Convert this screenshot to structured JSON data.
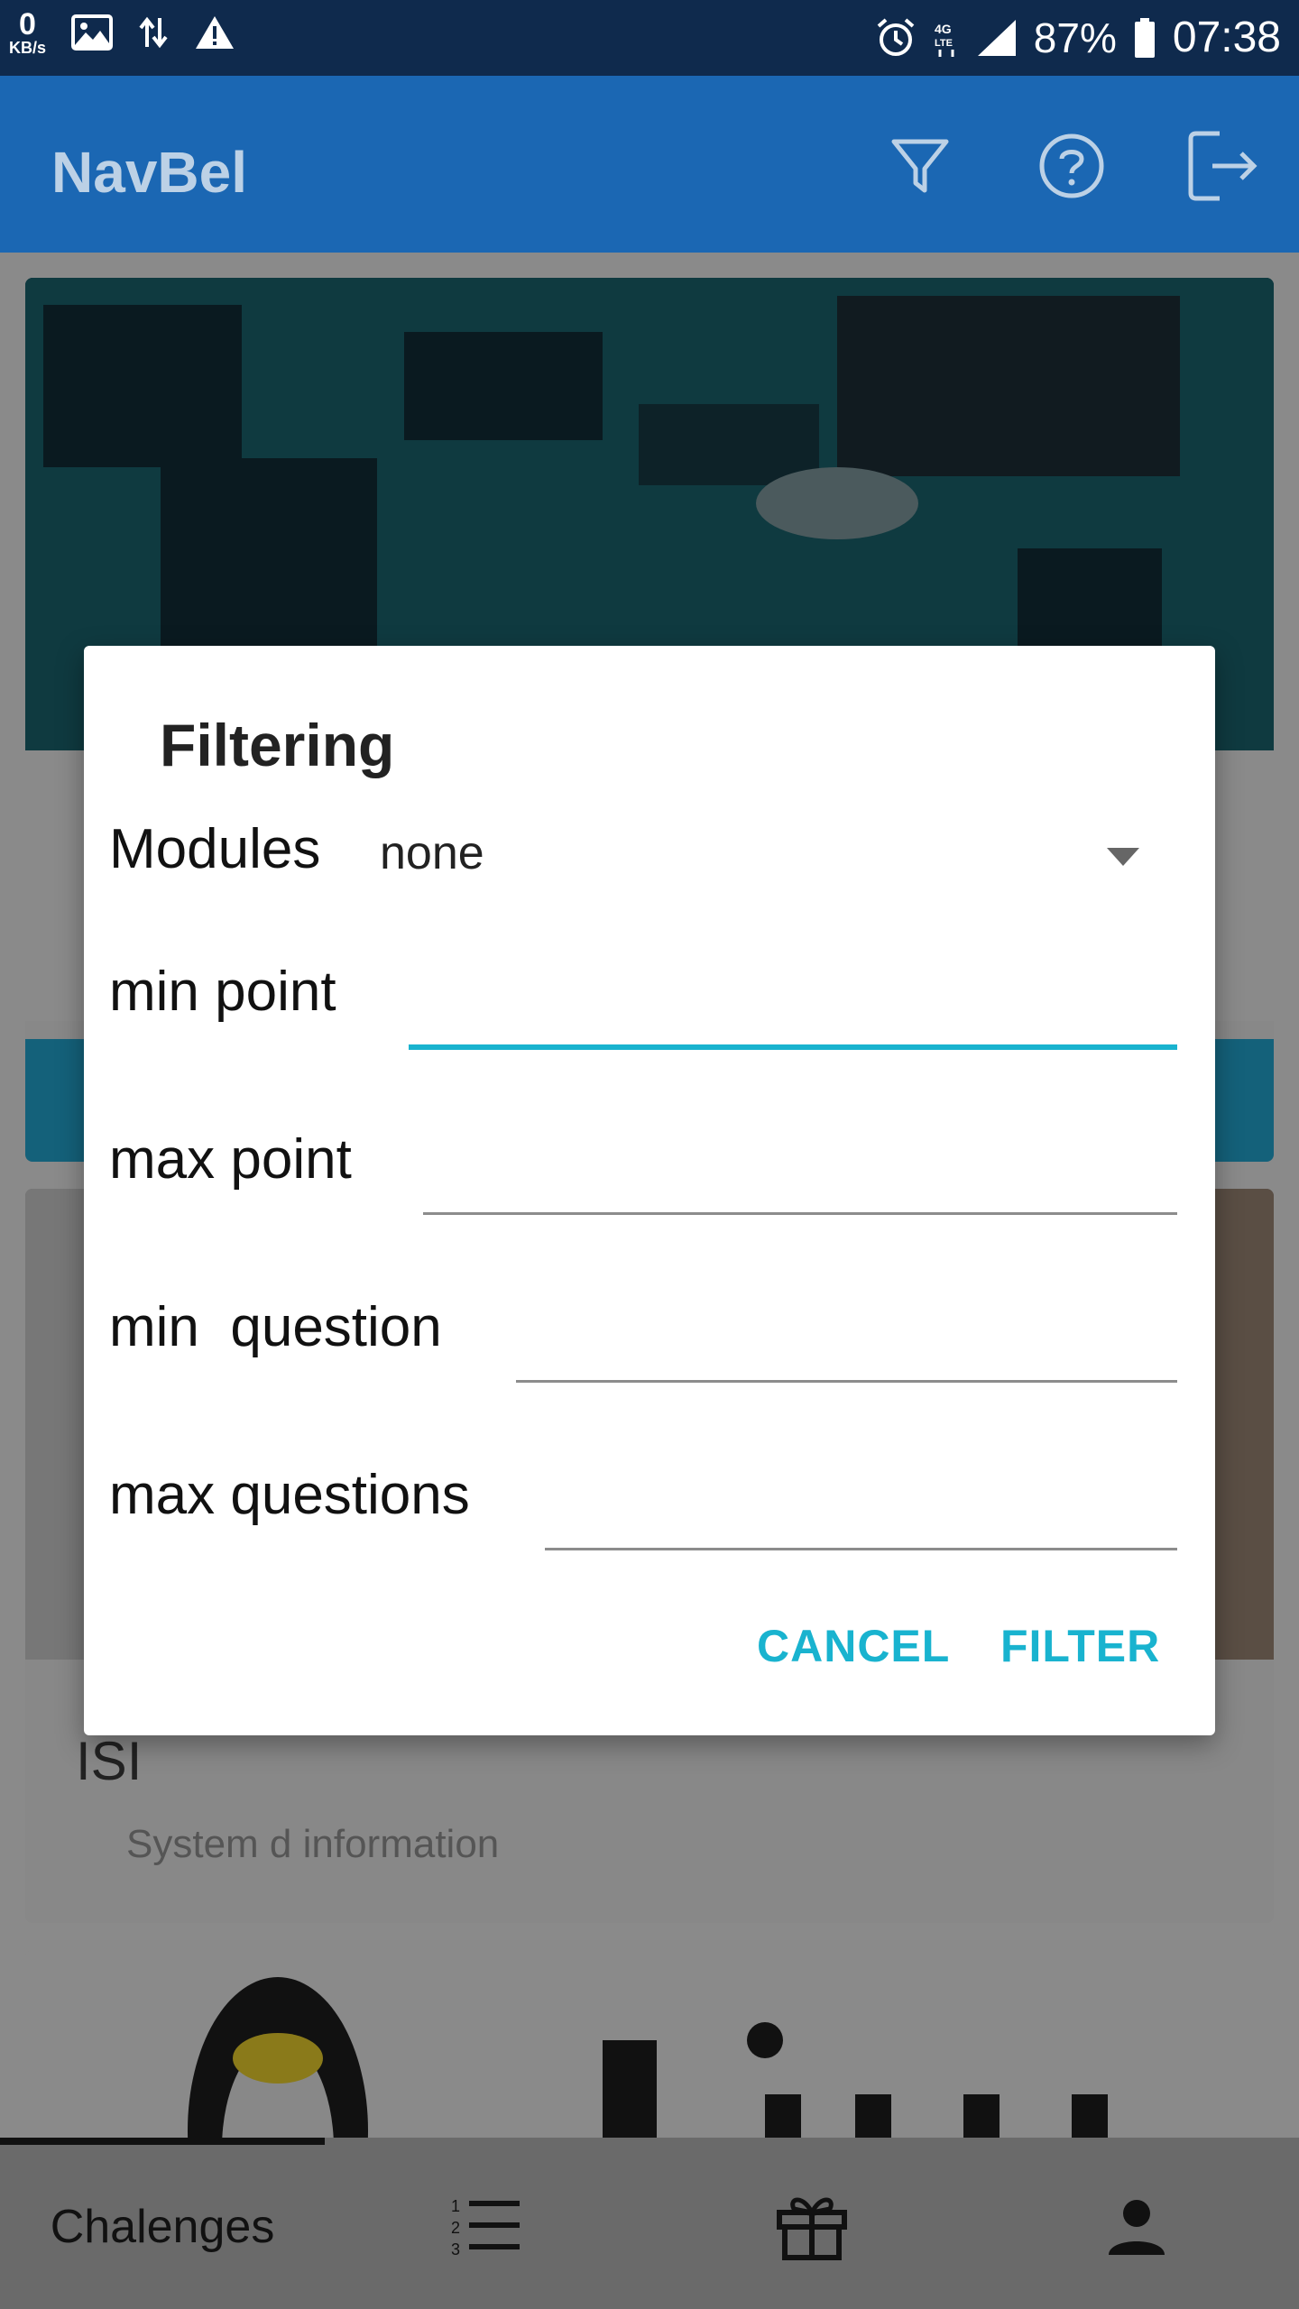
{
  "status_bar": {
    "net_speed_value": "0",
    "net_speed_unit": "KB/s",
    "network_type": "4G LTE",
    "battery_percent": "87%",
    "time": "07:38"
  },
  "app_bar": {
    "title": "NavBel",
    "icons": [
      "filter-icon",
      "help-icon",
      "logout-icon"
    ]
  },
  "cards": [
    {
      "image": "circuit-board-image"
    },
    {
      "title": "ISI",
      "subtitle": "System d information",
      "image": "office-photo-image"
    },
    {
      "image": "linux-logo-image"
    }
  ],
  "dialog": {
    "title": "Filtering",
    "modules_label": "Modules",
    "modules_selected": "none",
    "fields": [
      {
        "label": "min point",
        "value": ""
      },
      {
        "label": "max point",
        "value": ""
      },
      {
        "label": "min  question",
        "value": ""
      },
      {
        "label": "max questions",
        "value": ""
      }
    ],
    "cancel_label": "CANCEL",
    "filter_label": "FILTER"
  },
  "bottom_nav": {
    "tab1_label": "Chalenges",
    "icons": [
      "list-numbered-icon",
      "gift-icon",
      "person-icon"
    ]
  },
  "colors": {
    "status_bar": "#0f2a4d",
    "app_bar": "#1b67b3",
    "accent": "#19b3cf"
  }
}
